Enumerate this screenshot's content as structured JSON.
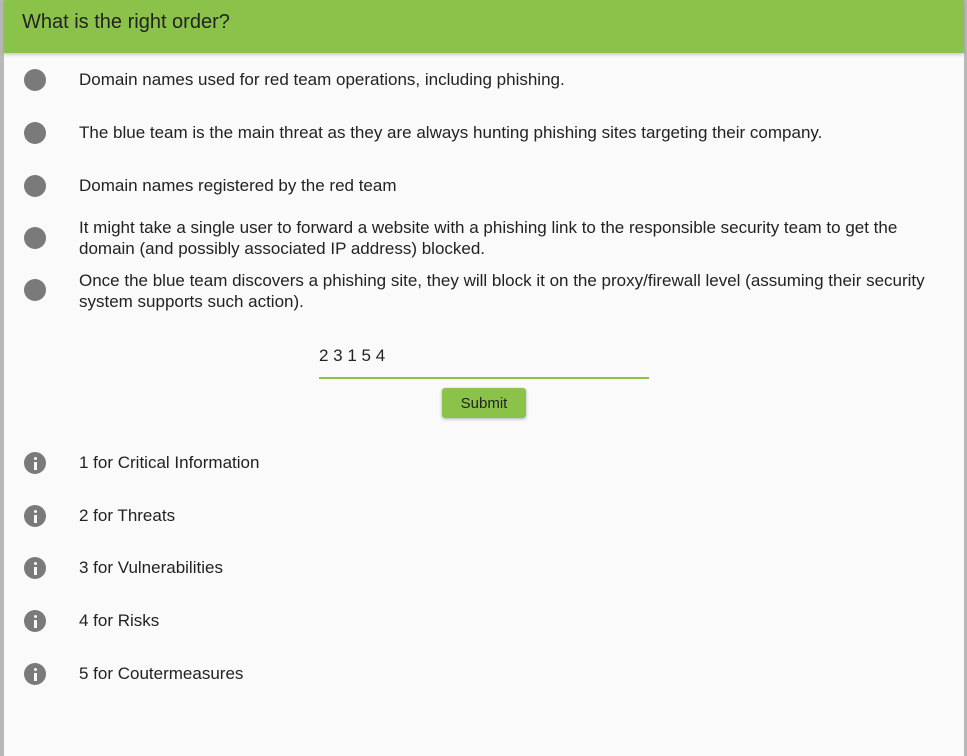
{
  "header": {
    "title": "What is the right order?"
  },
  "options": [
    {
      "label": "Domain names used for red team operations, including phishing."
    },
    {
      "label": "The blue team is the main threat as they are always hunting phishing sites targeting their company."
    },
    {
      "label": "Domain names registered by the red team"
    },
    {
      "label": "It might take a single user to forward a website with a phishing link to the responsible security team to get the domain (and possibly associated IP address) blocked."
    },
    {
      "label": "Once the blue team discovers a phishing site, they will block it on the proxy/firewall level (assuming their security system supports such action)."
    }
  ],
  "answer": {
    "value": "2 3 1 5 4"
  },
  "submit": {
    "label": "Submit"
  },
  "legend": [
    {
      "label": "1 for Critical Information"
    },
    {
      "label": "2 for Threats"
    },
    {
      "label": "3 for Vulnerabilities"
    },
    {
      "label": "4 for Risks"
    },
    {
      "label": "5 for Coutermeasures"
    }
  ],
  "colors": {
    "accent": "#8bc34a",
    "bullet": "#7a7a7a"
  }
}
